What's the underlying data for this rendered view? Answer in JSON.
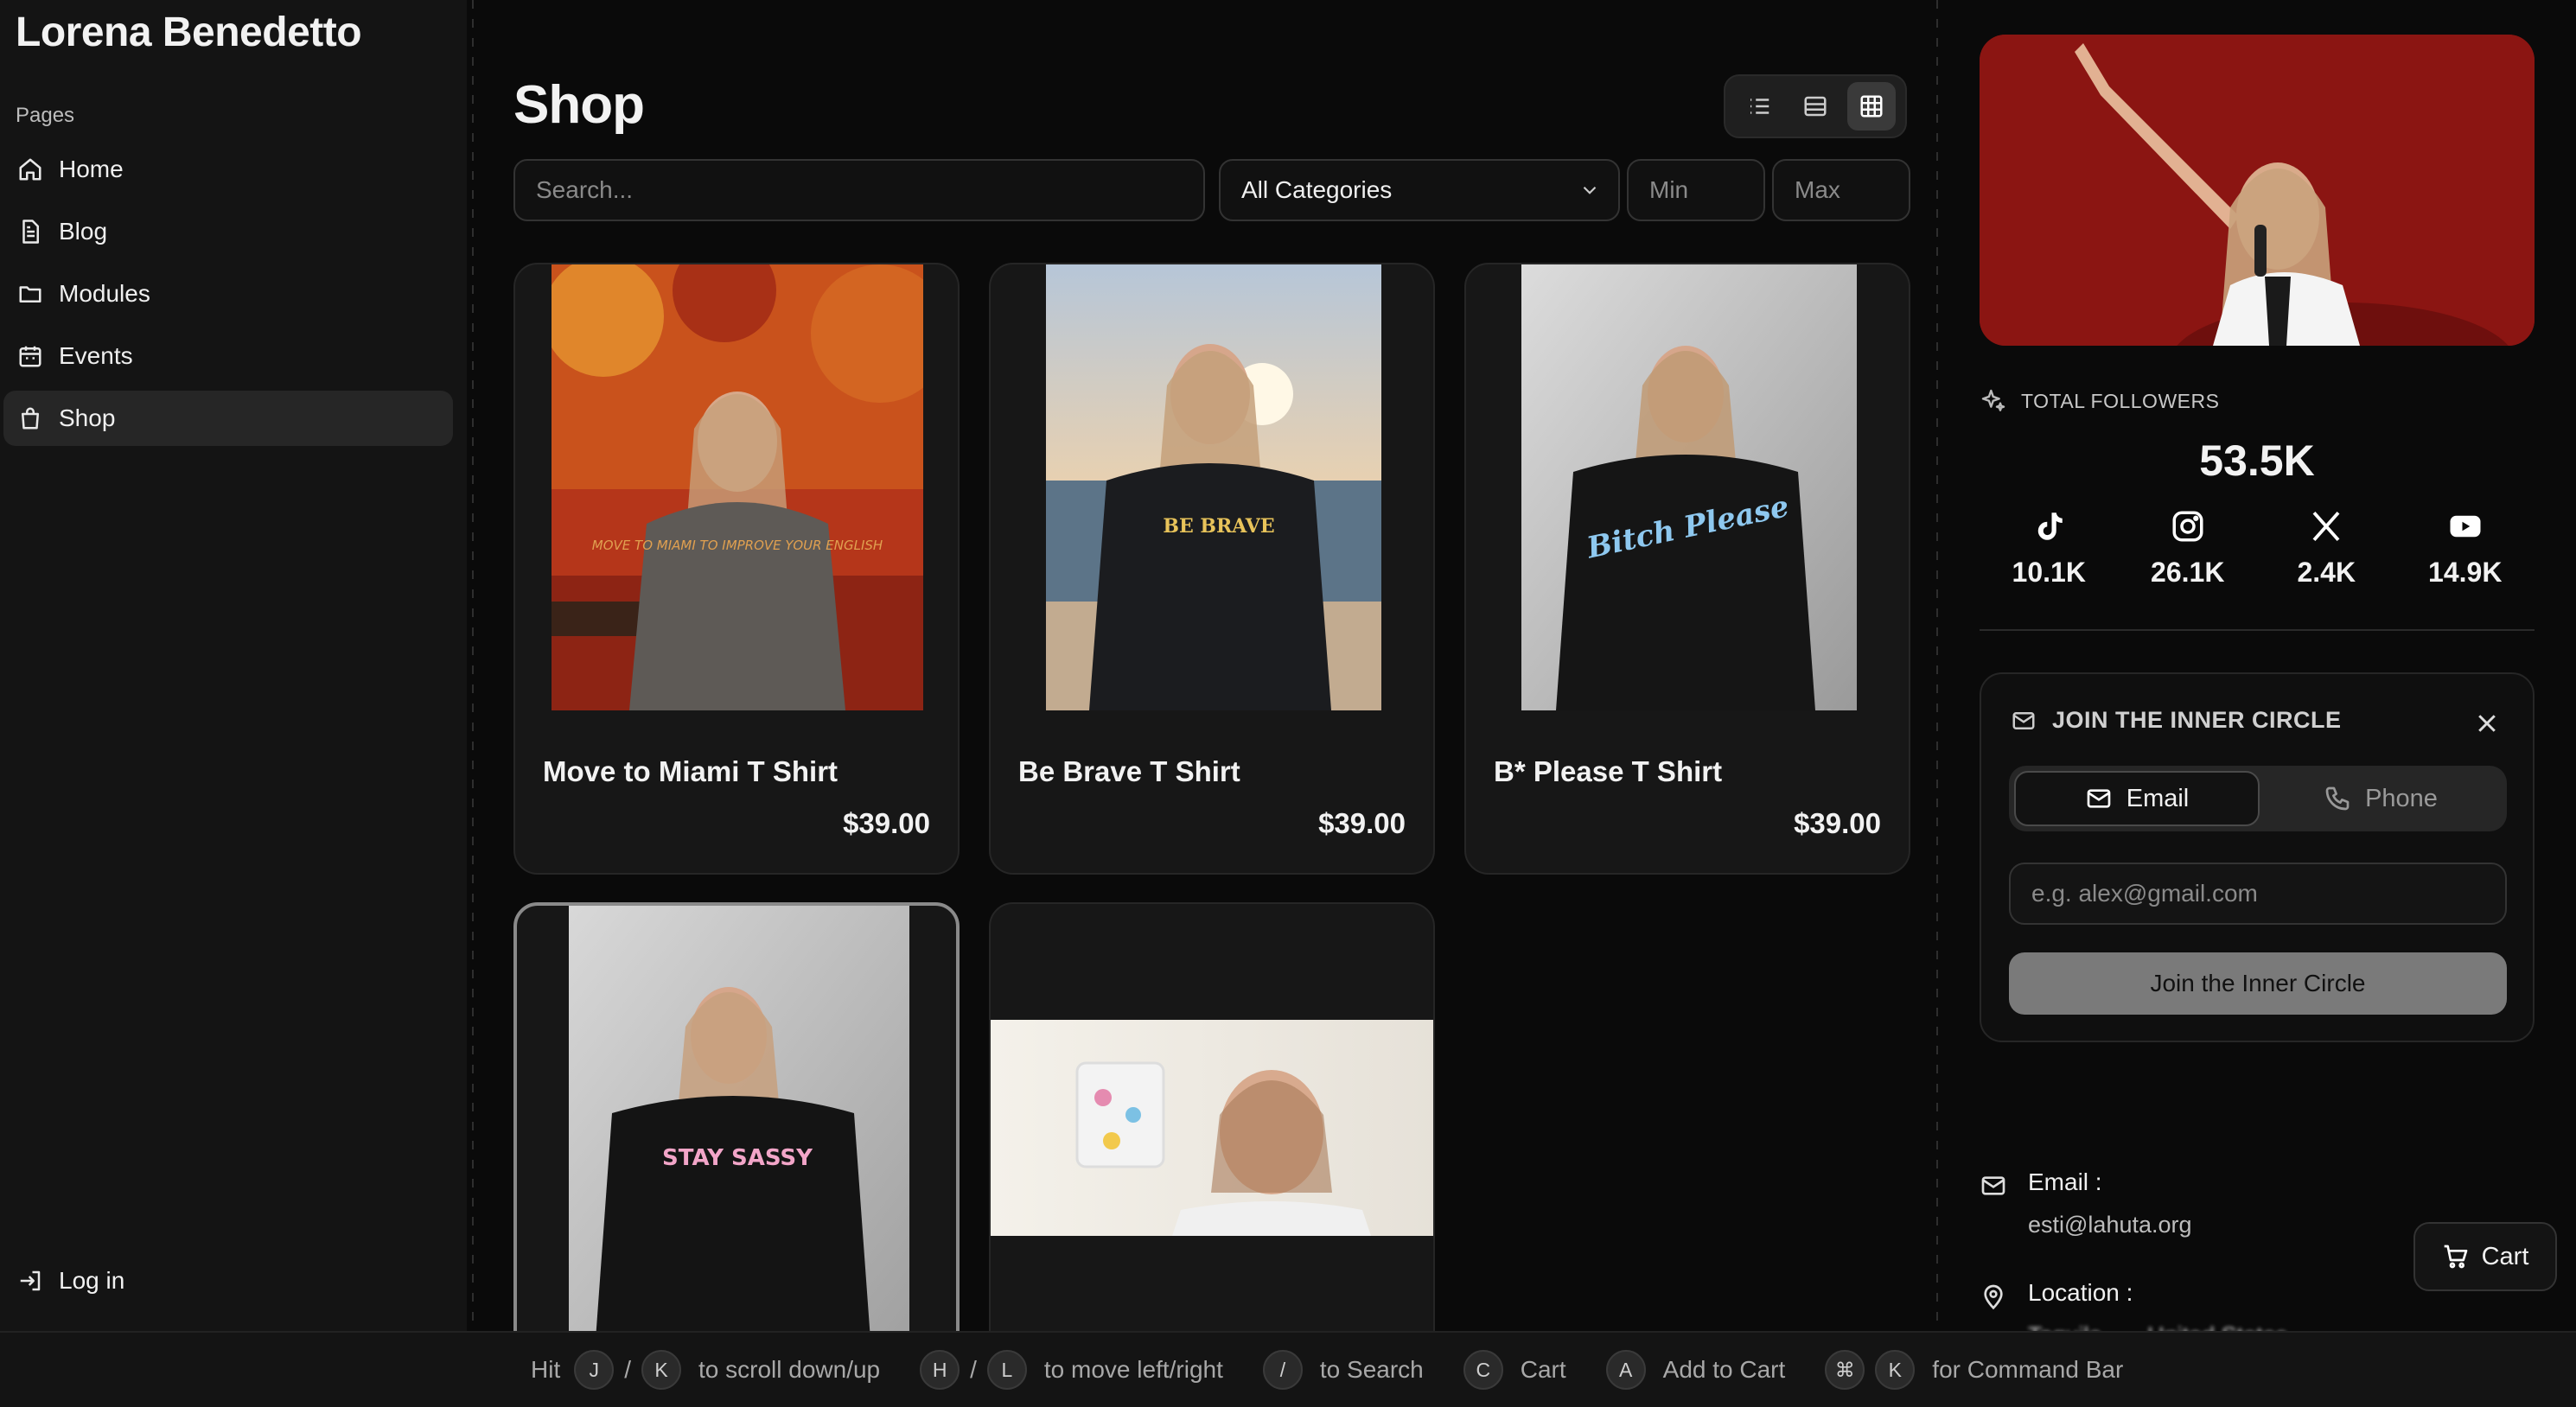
{
  "brand": "Lorena Benedetto",
  "sidebar": {
    "section_label": "Pages",
    "items": [
      {
        "label": "Home",
        "icon": "home-icon"
      },
      {
        "label": "Blog",
        "icon": "document-icon"
      },
      {
        "label": "Modules",
        "icon": "folder-icon"
      },
      {
        "label": "Events",
        "icon": "calendar-icon"
      },
      {
        "label": "Shop",
        "icon": "shopping-bag-icon",
        "active": true
      }
    ],
    "login_label": "Log in"
  },
  "main": {
    "title": "Shop",
    "view_modes": [
      "list",
      "rows",
      "grid"
    ],
    "active_view": "grid",
    "search_placeholder": "Search...",
    "category_value": "All Categories",
    "min_placeholder": "Min",
    "max_placeholder": "Max",
    "products": [
      {
        "name": "Move to Miami T Shirt",
        "price": "$39.00",
        "shirt_text": "MOVE TO MIAMI TO IMPROVE YOUR ENGLISH"
      },
      {
        "name": "Be Brave T Shirt",
        "price": "$39.00",
        "shirt_text": "BE BRAVE"
      },
      {
        "name": "B* Please T Shirt",
        "price": "$39.00",
        "shirt_text": "Bitch Please"
      },
      {
        "name": "",
        "price": "",
        "shirt_text": "STAY SASSY"
      },
      {
        "name": "",
        "price": ""
      }
    ]
  },
  "right": {
    "followers_label": "TOTAL FOLLOWERS",
    "followers_total": "53.5K",
    "socials": [
      {
        "icon": "tiktok-icon",
        "count": "10.1K"
      },
      {
        "icon": "instagram-icon",
        "count": "26.1K"
      },
      {
        "icon": "x-icon",
        "count": "2.4K"
      },
      {
        "icon": "youtube-icon",
        "count": "14.9K"
      }
    ],
    "inner_circle": {
      "title": "JOIN THE INNER CIRCLE",
      "tab_email": "Email",
      "tab_phone": "Phone",
      "active_tab": "Email",
      "input_placeholder": "e.g. alex@gmail.com",
      "button_label": "Join the Inner Circle"
    },
    "contact": {
      "email_label": "Email :",
      "email_value": "esti@lahuta.org",
      "location_label": "Location :",
      "location_value": "Tequila ... , United States"
    }
  },
  "cart_label": "Cart",
  "shortcuts": {
    "hit": "Hit",
    "k1": "J",
    "k2": "K",
    "t1": "to scroll down/up",
    "k3": "H",
    "k4": "L",
    "t2": "to move left/right",
    "k5": "/",
    "t3": "to Search",
    "k6": "C",
    "t4": "Cart",
    "k7": "A",
    "t5": "Add to Cart",
    "k8": "⌘",
    "k9": "K",
    "t6": "for Command Bar"
  },
  "colors": {
    "background": "#0a0a0a",
    "hero_red": "#8b1512",
    "accent_button": "#7a7a7a"
  }
}
